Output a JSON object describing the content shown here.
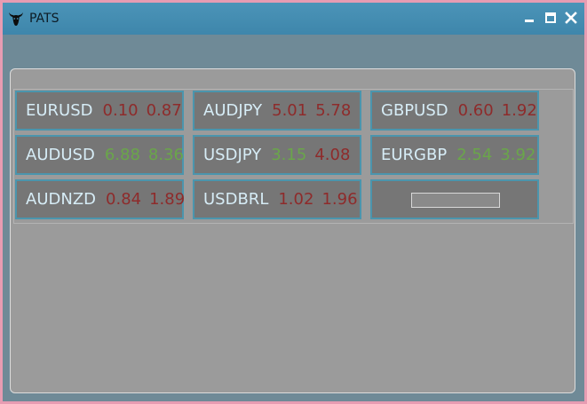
{
  "window": {
    "title": "PATS",
    "icon": "bull-icon",
    "controls": [
      "minimize-icon",
      "maximize-icon",
      "close-icon"
    ]
  },
  "colors": {
    "titlebar": "#4590b5",
    "frame": "#e79cb2",
    "client_bg": "#6f8a97",
    "panel_bg": "#9b9b9b",
    "cell_bg": "#767676",
    "cell_border": "#4b95ad",
    "symbol": "#d6ecf6",
    "negative": "#8e2b2b",
    "positive": "#6aa64a"
  },
  "pairs": [
    {
      "symbol": "EURUSD",
      "v1": "0.10",
      "c1": "red",
      "v2": "0.87",
      "c2": "red"
    },
    {
      "symbol": "AUDJPY",
      "v1": "5.01",
      "c1": "red",
      "v2": "5.78",
      "c2": "red"
    },
    {
      "symbol": "GBPUSD",
      "v1": "0.60",
      "c1": "red",
      "v2": "1.92",
      "c2": "red"
    },
    {
      "symbol": "AUDUSD",
      "v1": "6.88",
      "c1": "green",
      "v2": "8.36",
      "c2": "green"
    },
    {
      "symbol": "USDJPY",
      "v1": "3.15",
      "c1": "green",
      "v2": "4.08",
      "c2": "red"
    },
    {
      "symbol": "EURGBP",
      "v1": "2.54",
      "c1": "green",
      "v2": "3.92",
      "c2": "green"
    },
    {
      "symbol": "AUDNZD",
      "v1": "0.84",
      "c1": "red",
      "v2": "1.89",
      "c2": "red"
    },
    {
      "symbol": "USDBRL",
      "v1": "1.02",
      "c1": "red",
      "v2": "1.96",
      "c2": "red"
    }
  ],
  "empty_slot": {
    "input_value": ""
  }
}
